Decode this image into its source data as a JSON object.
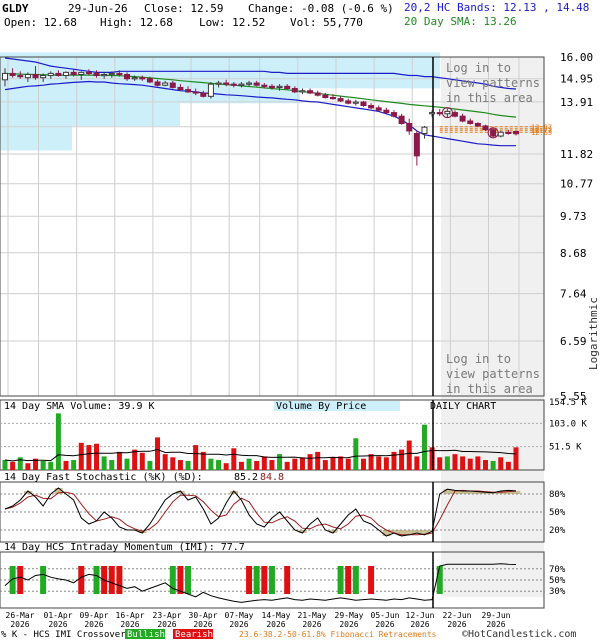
{
  "header": {
    "ticker": "GLDY",
    "date": "29-Jun-26",
    "close_label": "Close: 12.59",
    "change_label": "Change: -0.08 (-0.6 %)",
    "open_label": "Open: 12.68",
    "high_label": "High: 12.68",
    "low_label": "Low: 12.52",
    "vol_label": "Vol: 55,770",
    "bands_label": "20,2 HC Bands: 12.13 , 14.48",
    "sma_label": "20 Day SMA: 13.26"
  },
  "colors": {
    "bands": "#1c1cc8",
    "sma": "#1f8a1f",
    "up_candle": "#3a3a3a",
    "down_candle": "#8b1a4a",
    "vbp": "#cdeffa",
    "vol_up": "#22aa22",
    "vol_down": "#dd1111",
    "fib": "#e07b1a",
    "shade": "#f0f0f0",
    "osc_fill": "#cbbf94"
  },
  "notices": {
    "top": [
      "Log in to",
      "view patterns",
      "in this area"
    ],
    "bottom": [
      "Log in to",
      "view patterns",
      "in this area"
    ]
  },
  "scale_label": "Logarithmic",
  "daily_chart_label": "DAILY CHART",
  "vbp_label": "Volume By Price",
  "volume_panel": {
    "label": "14 Day SMA Volume: 39.9 K",
    "ticks": [
      "154.5 K",
      "103.0 K",
      "51.5 K"
    ]
  },
  "stoch_panel": {
    "label_prefix": "14 Day Fast Stochastic (%K) (%D):",
    "k_value": "85.2",
    "d_value": "84.8",
    "ticks": [
      "80%",
      "50%",
      "20%"
    ]
  },
  "imi_panel": {
    "label": "14 Day HCS Intraday Momentum (IMI): 77.7",
    "ticks": [
      "70%",
      "50%",
      "30%"
    ]
  },
  "footer": {
    "crossover_label": "% K - HCS IMI Crossover:",
    "bullish": "Bullish",
    "bearish": "Bearish",
    "fib_label": "23.6-38.2-50-61.8% Fibonacci Retracements",
    "copyright": "©HotCandlestick.com"
  },
  "chart_data": {
    "type": "candlestick",
    "y_scale": "log",
    "y_ticks": [
      16.0,
      14.95,
      13.91,
      12.87,
      11.82,
      10.77,
      9.73,
      8.68,
      7.64,
      6.59,
      5.55
    ],
    "y_tick_labels": [
      "16.00",
      "14.95",
      "13.91",
      "",
      "11.82",
      "10.77",
      "9.73",
      "8.68",
      "7.64",
      "6.59",
      "5.55"
    ],
    "x_tick_labels": [
      "26-Mar\n2026",
      "01-Apr\n2026",
      "09-Apr\n2026",
      "16-Apr\n2026",
      "23-Apr\n2026",
      "30-Apr\n2026",
      "07-May\n2026",
      "14-May\n2026",
      "21-May\n2026",
      "29-May\n2026",
      "05-Jun\n2026",
      "12-Jun\n2026",
      "22-Jun\n2026",
      "29-Jun\n2026"
    ],
    "fib_labels": [
      "12.87",
      "12.79",
      "12.73",
      "12.65"
    ],
    "candles": [
      {
        "o": 14.9,
        "h": 15.45,
        "l": 14.6,
        "c": 15.2
      },
      {
        "o": 15.2,
        "h": 15.45,
        "l": 15.0,
        "c": 15.1
      },
      {
        "o": 15.1,
        "h": 15.3,
        "l": 14.95,
        "c": 15.05
      },
      {
        "o": 15.0,
        "h": 15.25,
        "l": 14.8,
        "c": 15.15
      },
      {
        "o": 15.15,
        "h": 15.55,
        "l": 14.9,
        "c": 15.0
      },
      {
        "o": 15.0,
        "h": 15.2,
        "l": 14.8,
        "c": 15.1
      },
      {
        "o": 15.1,
        "h": 15.3,
        "l": 14.95,
        "c": 15.2
      },
      {
        "o": 15.2,
        "h": 15.35,
        "l": 15.05,
        "c": 15.1
      },
      {
        "o": 15.1,
        "h": 15.3,
        "l": 14.95,
        "c": 15.25
      },
      {
        "o": 15.25,
        "h": 15.4,
        "l": 15.05,
        "c": 15.15
      },
      {
        "o": 15.15,
        "h": 15.3,
        "l": 14.9,
        "c": 15.25
      },
      {
        "o": 15.25,
        "h": 15.4,
        "l": 15.1,
        "c": 15.2
      },
      {
        "o": 15.2,
        "h": 15.35,
        "l": 15.0,
        "c": 15.1
      },
      {
        "o": 15.1,
        "h": 15.25,
        "l": 14.95,
        "c": 15.15
      },
      {
        "o": 15.15,
        "h": 15.3,
        "l": 15.0,
        "c": 15.2
      },
      {
        "o": 15.2,
        "h": 15.35,
        "l": 15.05,
        "c": 15.15
      },
      {
        "o": 15.15,
        "h": 15.25,
        "l": 14.85,
        "c": 14.95
      },
      {
        "o": 14.95,
        "h": 15.1,
        "l": 14.85,
        "c": 15.0
      },
      {
        "o": 15.0,
        "h": 15.1,
        "l": 14.85,
        "c": 14.95
      },
      {
        "o": 14.95,
        "h": 15.05,
        "l": 14.75,
        "c": 14.8
      },
      {
        "o": 14.8,
        "h": 14.9,
        "l": 14.6,
        "c": 14.65
      },
      {
        "o": 14.65,
        "h": 14.85,
        "l": 14.6,
        "c": 14.75
      },
      {
        "o": 14.75,
        "h": 14.85,
        "l": 14.5,
        "c": 14.55
      },
      {
        "o": 14.55,
        "h": 14.7,
        "l": 14.4,
        "c": 14.45
      },
      {
        "o": 14.45,
        "h": 14.6,
        "l": 14.3,
        "c": 14.35
      },
      {
        "o": 14.35,
        "h": 14.5,
        "l": 14.2,
        "c": 14.3
      },
      {
        "o": 14.3,
        "h": 14.4,
        "l": 14.1,
        "c": 14.15
      },
      {
        "o": 14.15,
        "h": 14.8,
        "l": 14.05,
        "c": 14.7
      },
      {
        "o": 14.7,
        "h": 14.85,
        "l": 14.55,
        "c": 14.75
      },
      {
        "o": 14.75,
        "h": 14.9,
        "l": 14.6,
        "c": 14.7
      },
      {
        "o": 14.7,
        "h": 14.8,
        "l": 14.55,
        "c": 14.65
      },
      {
        "o": 14.65,
        "h": 14.8,
        "l": 14.55,
        "c": 14.7
      },
      {
        "o": 14.7,
        "h": 14.85,
        "l": 14.6,
        "c": 14.75
      },
      {
        "o": 14.75,
        "h": 14.85,
        "l": 14.6,
        "c": 14.65
      },
      {
        "o": 14.65,
        "h": 14.75,
        "l": 14.5,
        "c": 14.6
      },
      {
        "o": 14.6,
        "h": 14.7,
        "l": 14.45,
        "c": 14.55
      },
      {
        "o": 14.55,
        "h": 14.7,
        "l": 14.4,
        "c": 14.6
      },
      {
        "o": 14.6,
        "h": 14.7,
        "l": 14.45,
        "c": 14.5
      },
      {
        "o": 14.5,
        "h": 14.6,
        "l": 14.3,
        "c": 14.35
      },
      {
        "o": 14.35,
        "h": 14.5,
        "l": 14.25,
        "c": 14.4
      },
      {
        "o": 14.4,
        "h": 14.5,
        "l": 14.25,
        "c": 14.3
      },
      {
        "o": 14.3,
        "h": 14.4,
        "l": 14.15,
        "c": 14.2
      },
      {
        "o": 14.2,
        "h": 14.3,
        "l": 14.05,
        "c": 14.1
      },
      {
        "o": 14.1,
        "h": 14.25,
        "l": 14.0,
        "c": 14.05
      },
      {
        "o": 14.05,
        "h": 14.15,
        "l": 13.9,
        "c": 13.95
      },
      {
        "o": 13.95,
        "h": 14.05,
        "l": 13.8,
        "c": 13.85
      },
      {
        "o": 13.85,
        "h": 14.0,
        "l": 13.75,
        "c": 13.9
      },
      {
        "o": 13.9,
        "h": 13.95,
        "l": 13.7,
        "c": 13.75
      },
      {
        "o": 13.75,
        "h": 13.85,
        "l": 13.6,
        "c": 13.65
      },
      {
        "o": 13.65,
        "h": 13.75,
        "l": 13.5,
        "c": 13.55
      },
      {
        "o": 13.55,
        "h": 13.65,
        "l": 13.4,
        "c": 13.45
      },
      {
        "o": 13.45,
        "h": 13.55,
        "l": 13.25,
        "c": 13.3
      },
      {
        "o": 13.3,
        "h": 13.4,
        "l": 12.95,
        "c": 13.0
      },
      {
        "o": 13.0,
        "h": 13.2,
        "l": 12.55,
        "c": 12.7
      },
      {
        "o": 12.6,
        "h": 12.7,
        "l": 11.4,
        "c": 11.75
      },
      {
        "o": 12.6,
        "h": 12.9,
        "l": 12.4,
        "c": 12.85
      },
      {
        "o": 13.4,
        "h": 13.55,
        "l": 13.25,
        "c": 13.45
      },
      {
        "o": 13.45,
        "h": 13.6,
        "l": 13.3,
        "c": 13.4
      },
      {
        "o": 13.4,
        "h": 13.6,
        "l": 13.25,
        "c": 13.5
      },
      {
        "o": 13.45,
        "h": 13.55,
        "l": 13.25,
        "c": 13.3
      },
      {
        "o": 13.3,
        "h": 13.4,
        "l": 13.05,
        "c": 13.1
      },
      {
        "o": 13.1,
        "h": 13.2,
        "l": 12.95,
        "c": 13.0
      },
      {
        "o": 13.0,
        "h": 13.05,
        "l": 12.85,
        "c": 12.9
      },
      {
        "o": 12.9,
        "h": 12.95,
        "l": 12.7,
        "c": 12.75
      },
      {
        "o": 12.75,
        "h": 12.85,
        "l": 12.45,
        "c": 12.5
      },
      {
        "o": 12.5,
        "h": 12.7,
        "l": 12.45,
        "c": 12.65
      },
      {
        "o": 12.65,
        "h": 12.75,
        "l": 12.55,
        "c": 12.6
      },
      {
        "o": 12.68,
        "h": 12.68,
        "l": 12.52,
        "c": 12.59
      }
    ],
    "upper_band": [
      15.95,
      15.9,
      15.85,
      15.8,
      15.75,
      15.65,
      15.55,
      15.5,
      15.45,
      15.4,
      15.35,
      15.3,
      15.25,
      15.25,
      15.25,
      15.3,
      15.3,
      15.3,
      15.3,
      15.3,
      15.3,
      15.3,
      15.3,
      15.3,
      15.3,
      15.3,
      15.3,
      15.3,
      15.3,
      15.3,
      15.3,
      15.3,
      15.3,
      15.3,
      15.3,
      15.25,
      15.25,
      15.2,
      15.2,
      15.2,
      15.2,
      15.2,
      15.2,
      15.2,
      15.2,
      15.2,
      15.2,
      15.2,
      15.2,
      15.2,
      15.2,
      15.2,
      15.15,
      15.1,
      15.1,
      15.05,
      15.05,
      15.0,
      14.95,
      14.9,
      14.85,
      14.8,
      14.75,
      14.7,
      14.6,
      14.55,
      14.5,
      14.48
    ],
    "lower_band": [
      14.45,
      14.5,
      14.55,
      14.6,
      14.62,
      14.65,
      14.7,
      14.72,
      14.75,
      14.78,
      14.8,
      14.82,
      14.8,
      14.8,
      14.75,
      14.72,
      14.7,
      14.68,
      14.65,
      14.6,
      14.55,
      14.5,
      14.45,
      14.4,
      14.38,
      14.35,
      14.3,
      14.28,
      14.25,
      14.22,
      14.2,
      14.18,
      14.15,
      14.12,
      14.1,
      14.08,
      14.05,
      14.02,
      14.0,
      13.95,
      13.92,
      13.9,
      13.85,
      13.8,
      13.75,
      13.7,
      13.65,
      13.6,
      13.55,
      13.5,
      13.4,
      13.3,
      13.15,
      12.95,
      12.7,
      12.55,
      12.5,
      12.45,
      12.4,
      12.35,
      12.3,
      12.25,
      12.2,
      12.18,
      12.15,
      12.13,
      12.13,
      12.13
    ],
    "sma": [
      15.2,
      15.18,
      15.17,
      15.16,
      15.15,
      15.14,
      15.13,
      15.12,
      15.12,
      15.12,
      15.12,
      15.12,
      15.12,
      15.11,
      15.1,
      15.09,
      15.07,
      15.05,
      15.02,
      14.99,
      14.96,
      14.93,
      14.9,
      14.86,
      14.83,
      14.8,
      14.77,
      14.74,
      14.71,
      14.68,
      14.65,
      14.62,
      14.59,
      14.56,
      14.53,
      14.5,
      14.47,
      14.44,
      14.4,
      14.36,
      14.32,
      14.28,
      14.24,
      14.2,
      14.16,
      14.12,
      14.08,
      14.04,
      14.0,
      13.96,
      13.92,
      13.88,
      13.84,
      13.8,
      13.77,
      13.74,
      13.71,
      13.68,
      13.64,
      13.6,
      13.56,
      13.52,
      13.48,
      13.44,
      13.38,
      13.33,
      13.29,
      13.26
    ],
    "volume": [
      22,
      18,
      28,
      15,
      25,
      20,
      18,
      125,
      20,
      22,
      60,
      55,
      58,
      30,
      22,
      40,
      25,
      45,
      38,
      20,
      72,
      35,
      28,
      22,
      20,
      55,
      40,
      25,
      22,
      15,
      48,
      18,
      25,
      20,
      30,
      22,
      35,
      18,
      25,
      28,
      35,
      40,
      22,
      28,
      30,
      25,
      70,
      25,
      35,
      30,
      28,
      40,
      45,
      65,
      30,
      100,
      50,
      28,
      30,
      35,
      30,
      25,
      30,
      22,
      20,
      28,
      18,
      50
    ],
    "volume_up": [
      true,
      false,
      true,
      false,
      false,
      true,
      true,
      true,
      false,
      true,
      false,
      false,
      false,
      true,
      true,
      false,
      true,
      false,
      false,
      true,
      false,
      false,
      false,
      false,
      true,
      false,
      false,
      true,
      true,
      false,
      false,
      false,
      true,
      false,
      false,
      false,
      true,
      false,
      false,
      false,
      false,
      false,
      false,
      false,
      false,
      false,
      true,
      false,
      false,
      false,
      false,
      false,
      false,
      false,
      false,
      true,
      false,
      false,
      true,
      false,
      false,
      false,
      false,
      false,
      true,
      false,
      false,
      false
    ],
    "stoch_k": [
      55,
      60,
      70,
      85,
      75,
      60,
      80,
      90,
      80,
      70,
      40,
      30,
      35,
      50,
      40,
      25,
      20,
      20,
      15,
      30,
      50,
      70,
      80,
      85,
      70,
      75,
      55,
      30,
      40,
      65,
      85,
      70,
      45,
      30,
      25,
      40,
      50,
      35,
      20,
      15,
      30,
      40,
      20,
      15,
      30,
      45,
      55,
      35,
      30,
      20,
      10,
      15,
      10,
      12,
      15,
      12,
      18,
      80,
      88,
      86,
      85,
      85,
      84,
      83,
      82,
      85,
      86,
      85.2
    ],
    "stoch_d": [
      55,
      58,
      65,
      75,
      78,
      73,
      72,
      82,
      83,
      80,
      63,
      47,
      35,
      38,
      42,
      38,
      28,
      22,
      18,
      22,
      32,
      50,
      67,
      78,
      78,
      77,
      67,
      53,
      42,
      45,
      63,
      73,
      67,
      48,
      33,
      32,
      38,
      42,
      35,
      23,
      22,
      28,
      30,
      25,
      22,
      30,
      43,
      45,
      40,
      28,
      20,
      15,
      12,
      12,
      12,
      13,
      15,
      37,
      62,
      85,
      86,
      85,
      85,
      84,
      83,
      83,
      84,
      84.8
    ],
    "imi": [
      40,
      52,
      55,
      50,
      58,
      60,
      55,
      52,
      50,
      45,
      55,
      60,
      58,
      50,
      45,
      40,
      35,
      38,
      30,
      35,
      40,
      45,
      35,
      30,
      25,
      20,
      28,
      22,
      18,
      15,
      12,
      10,
      12,
      14,
      15,
      14,
      16,
      18,
      15,
      14,
      16,
      15,
      14,
      16,
      18,
      16,
      14,
      15,
      16,
      15,
      14,
      16,
      15,
      18,
      16,
      14,
      15,
      75,
      78,
      78,
      78,
      78,
      78,
      78,
      78,
      79,
      78,
      77.7
    ],
    "crossovers": [
      {
        "i": 1,
        "type": "bull"
      },
      {
        "i": 2,
        "type": "bear"
      },
      {
        "i": 5,
        "type": "bull"
      },
      {
        "i": 10,
        "type": "bear"
      },
      {
        "i": 12,
        "type": "bull"
      },
      {
        "i": 13,
        "type": "bear"
      },
      {
        "i": 14,
        "type": "bear"
      },
      {
        "i": 15,
        "type": "bear"
      },
      {
        "i": 22,
        "type": "bull"
      },
      {
        "i": 23,
        "type": "bear"
      },
      {
        "i": 24,
        "type": "bull"
      },
      {
        "i": 32,
        "type": "bear"
      },
      {
        "i": 33,
        "type": "bull"
      },
      {
        "i": 34,
        "type": "bear"
      },
      {
        "i": 35,
        "type": "bull"
      },
      {
        "i": 37,
        "type": "bear"
      },
      {
        "i": 44,
        "type": "bull"
      },
      {
        "i": 45,
        "type": "bear"
      },
      {
        "i": 46,
        "type": "bull"
      },
      {
        "i": 48,
        "type": "bear"
      },
      {
        "i": 57,
        "type": "bull"
      }
    ],
    "vbp_levels": [
      {
        "price": 15.3,
        "width": 440
      },
      {
        "price": 14.6,
        "width": 300
      },
      {
        "price": 13.6,
        "width": 180
      },
      {
        "price": 12.6,
        "width": 72
      }
    ]
  }
}
